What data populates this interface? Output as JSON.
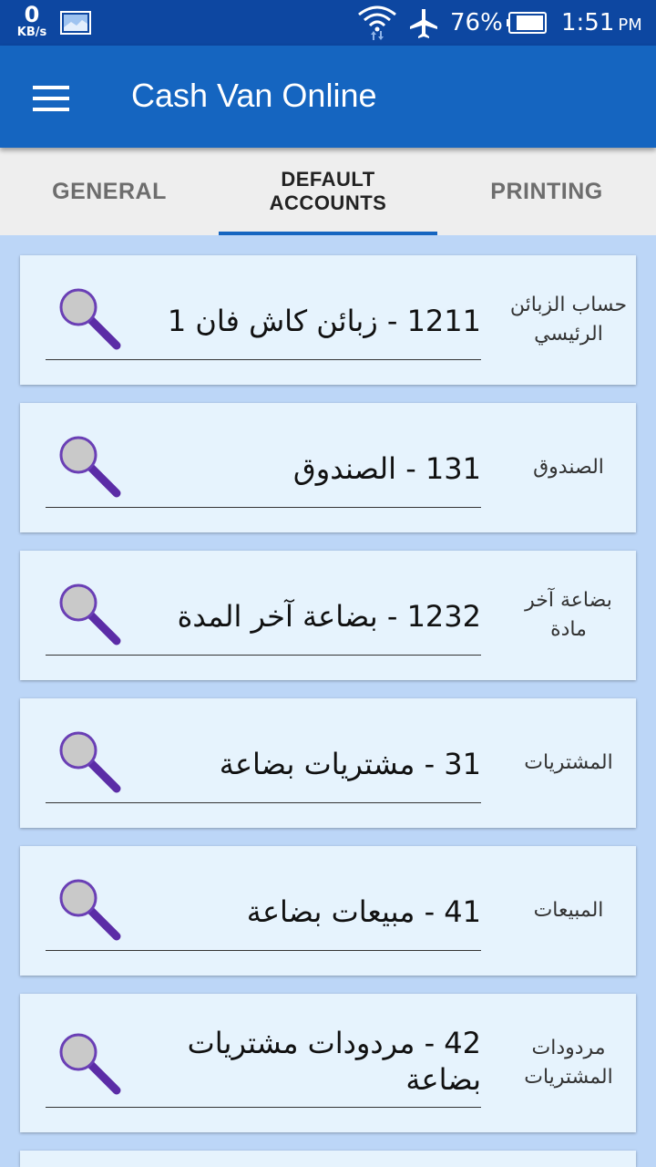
{
  "status_bar": {
    "speed_value": "0",
    "speed_unit": "KB/s",
    "battery_pct": "76%",
    "time": "1:51",
    "ampm": "PM"
  },
  "app_bar": {
    "title": "Cash Van Online"
  },
  "tabs": [
    {
      "label": "GENERAL",
      "active": false
    },
    {
      "label": "DEFAULT ACCOUNTS",
      "active": true
    },
    {
      "label": "PRINTING",
      "active": false
    }
  ],
  "accounts": [
    {
      "label": "حساب الزبائن الرئيسي",
      "value": "1211 - زبائن كاش فان 1"
    },
    {
      "label": "الصندوق",
      "value": "131 - الصندوق"
    },
    {
      "label": "بضاعة آخر مادة",
      "value": "1232 - بضاعة آخر المدة"
    },
    {
      "label": "المشتريات",
      "value": "31 - مشتريات بضاعة"
    },
    {
      "label": "المبيعات",
      "value": "41 - مبيعات بضاعة"
    },
    {
      "label": "مردودات المشتريات",
      "value": "42 - مردودات مشتريات بضاعة"
    }
  ],
  "colors": {
    "status_bar": "#0d47a1",
    "app_bar": "#1565c0",
    "tab_indicator": "#1565c0",
    "content_bg": "#bcd6f7",
    "card_bg": "#e6f3fd",
    "search_icon_ring": "#5e35b1"
  }
}
